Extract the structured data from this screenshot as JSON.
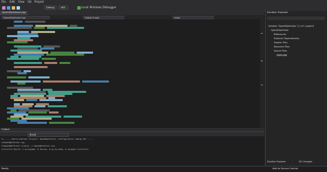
{
  "menubar": {
    "items": [
      "File",
      "Edit",
      "View",
      "Git",
      "Project",
      "Build",
      "Debug",
      "Test",
      "Analyze",
      "Tools",
      "Extensions",
      "Window",
      "Help"
    ]
  },
  "toolbar": {
    "config": "Debug",
    "platform": "x64",
    "run_target": "Local Windows Debugger",
    "search_placeholder": "Search"
  },
  "editor": {
    "tab": "SpeedOptimizer.cpp",
    "nav": {
      "scope": "Global Scope",
      "member": "main"
    }
  },
  "output": {
    "tab": "Output",
    "source": "Build",
    "lines": [
      "1>------ Build started: Project: SpeedOptimizer, Configuration: Debug x64 ------",
      "1>SpeedOptimizer.cpp",
      "1>SpeedOptimizer.vcxproj -> SpeedOptimizer.exe",
      "========== Build: 1 succeeded, 0 failed, 0 up-to-date, 0 skipped =========="
    ]
  },
  "solution_explorer": {
    "title": "Solution Explorer",
    "search_placeholder": "Search Solution Explorer (Ctrl+;)",
    "items": [
      {
        "label": "Solution 'SpeedOptimizer' (1 of 1 project)",
        "indent": 0
      },
      {
        "label": "SpeedOptimizer",
        "indent": 1
      },
      {
        "label": "References",
        "indent": 2
      },
      {
        "label": "External Dependencies",
        "indent": 2
      },
      {
        "label": "Header Files",
        "indent": 2
      },
      {
        "label": "Resource Files",
        "indent": 2
      },
      {
        "label": "Source Files",
        "indent": 2
      },
      {
        "label": "main.cpp",
        "indent": 3
      }
    ],
    "bottom_tabs": [
      "Solution Explorer",
      "Git Changes"
    ]
  },
  "status": {
    "left": "Ready",
    "right": "Add to Source Control"
  }
}
